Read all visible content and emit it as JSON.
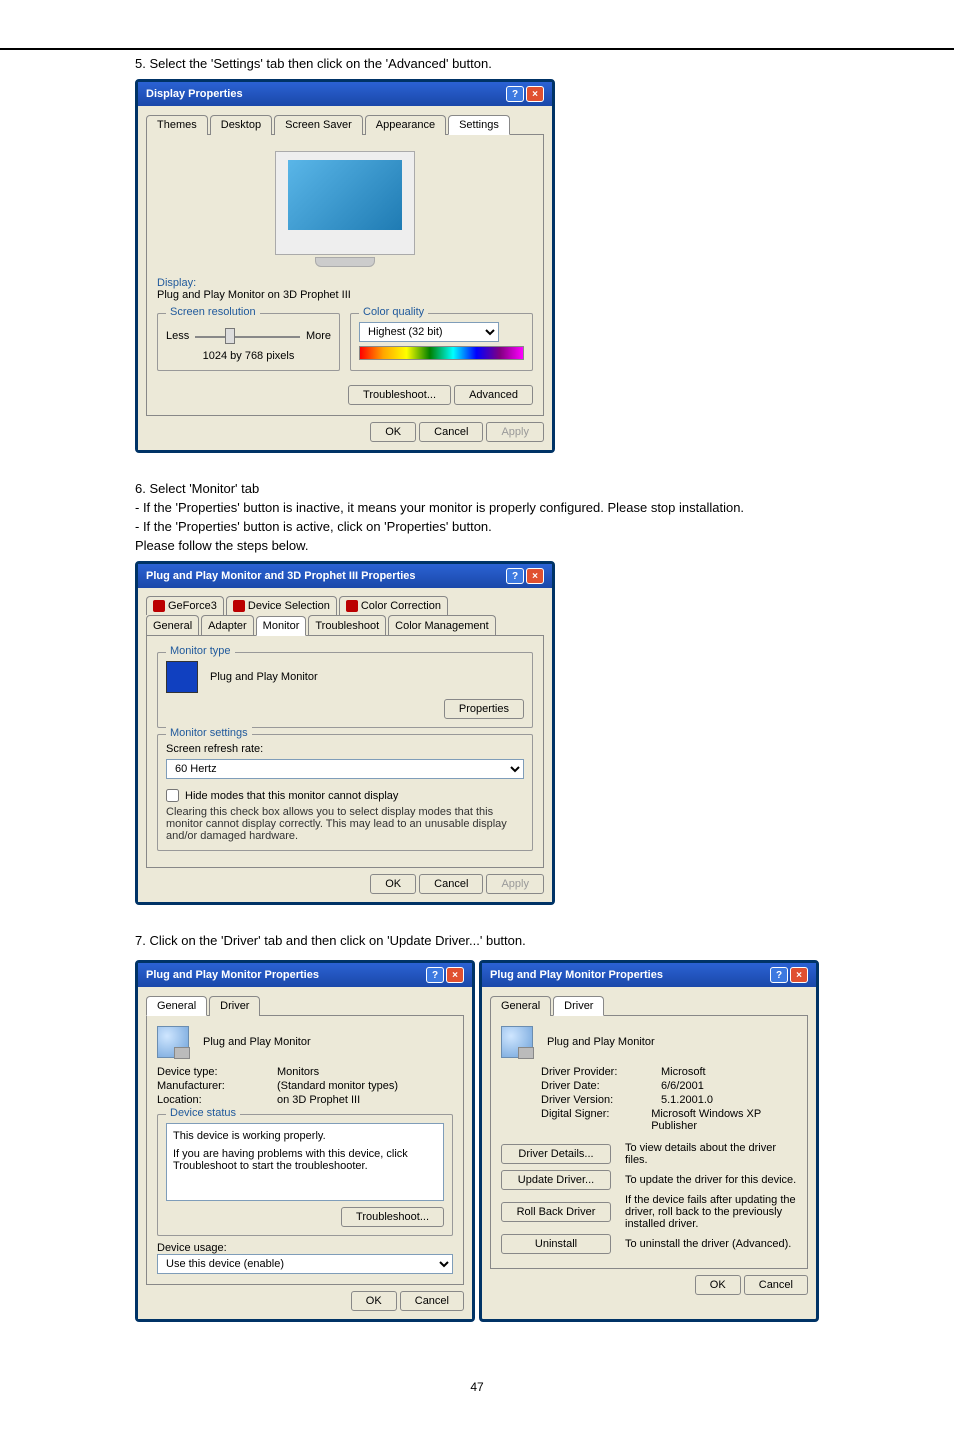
{
  "page": {
    "number": "47"
  },
  "step5": {
    "text": "5. Select the 'Settings' tab then click on the 'Advanced' button."
  },
  "display_props": {
    "title": "Display Properties",
    "tabs": [
      "Themes",
      "Desktop",
      "Screen Saver",
      "Appearance",
      "Settings"
    ],
    "display_label": "Display:",
    "display_value": "Plug and Play Monitor on 3D Prophet III",
    "resolution_legend": "Screen resolution",
    "less": "Less",
    "more": "More",
    "res_value": "1024 by 768 pixels",
    "color_legend": "Color quality",
    "color_value": "Highest (32 bit)",
    "troubleshoot": "Troubleshoot...",
    "advanced": "Advanced",
    "ok": "OK",
    "cancel": "Cancel",
    "apply": "Apply"
  },
  "step6": {
    "line1": "6. Select 'Monitor' tab",
    "line2": "- If the 'Properties' button is inactive, it means your monitor is properly configured. Please stop installation.",
    "line3": "- If the 'Properties' button is active, click on 'Properties' button.",
    "line4": "Please follow the steps below."
  },
  "adv_dialog": {
    "title": "Plug and Play Monitor and 3D Prophet III Properties",
    "tabs_top": [
      "GeForce3",
      "Device Selection",
      "Color Correction"
    ],
    "tabs_bot": [
      "General",
      "Adapter",
      "Monitor",
      "Troubleshoot",
      "Color Management"
    ],
    "type_legend": "Monitor type",
    "type_value": "Plug and Play Monitor",
    "properties": "Properties",
    "settings_legend": "Monitor settings",
    "refresh_label": "Screen refresh rate:",
    "refresh_value": "60 Hertz",
    "checkbox_label": "Hide modes that this monitor cannot display",
    "warn": "Clearing this check box allows you to select display modes that this monitor cannot display correctly. This may lead to an unusable display and/or damaged hardware.",
    "ok": "OK",
    "cancel": "Cancel",
    "apply": "Apply"
  },
  "step7": {
    "text": "7. Click on the 'Driver' tab and then click on 'Update Driver...' button."
  },
  "props_general": {
    "title": "Plug and Play Monitor Properties",
    "tabs": [
      "General",
      "Driver"
    ],
    "name": "Plug and Play Monitor",
    "dt_l": "Device type:",
    "dt_v": "Monitors",
    "mf_l": "Manufacturer:",
    "mf_v": "(Standard monitor types)",
    "lo_l": "Location:",
    "lo_v": "on 3D Prophet III",
    "status_legend": "Device status",
    "status_text": "This device is working properly.",
    "status_help": "If you are having problems with this device, click Troubleshoot to start the troubleshooter.",
    "troubleshoot": "Troubleshoot...",
    "usage_l": "Device usage:",
    "usage_v": "Use this device (enable)",
    "ok": "OK",
    "cancel": "Cancel"
  },
  "props_driver": {
    "title": "Plug and Play Monitor Properties",
    "tabs": [
      "General",
      "Driver"
    ],
    "name": "Plug and Play Monitor",
    "dp_l": "Driver Provider:",
    "dp_v": "Microsoft",
    "dd_l": "Driver Date:",
    "dd_v": "6/6/2001",
    "dv_l": "Driver Version:",
    "dv_v": "5.1.2001.0",
    "ds_l": "Digital Signer:",
    "ds_v": "Microsoft Windows XP Publisher",
    "btn_details": "Driver Details...",
    "txt_details": "To view details about the driver files.",
    "btn_update": "Update Driver...",
    "txt_update": "To update the driver for this device.",
    "btn_roll": "Roll Back Driver",
    "txt_roll": "If the device fails after updating the driver, roll back to the previously installed driver.",
    "btn_uninstall": "Uninstall",
    "txt_uninstall": "To uninstall the driver (Advanced).",
    "ok": "OK",
    "cancel": "Cancel"
  }
}
